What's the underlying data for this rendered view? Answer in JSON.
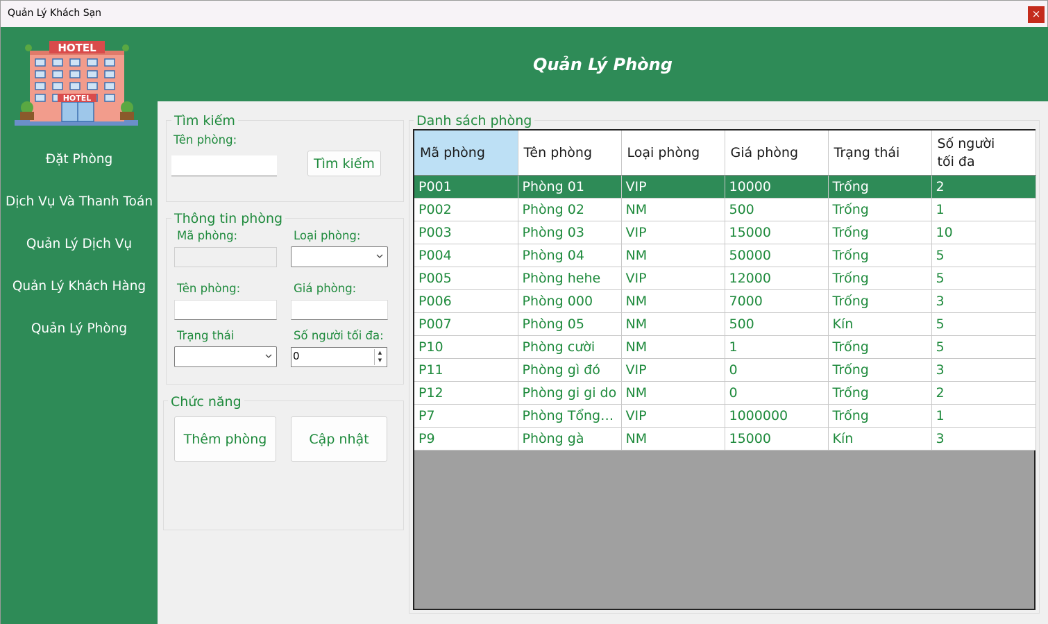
{
  "window": {
    "title": "Quản Lý Khách Sạn",
    "close_label": "×"
  },
  "sidebar": {
    "logo_text_top": "HOTEL",
    "logo_text_door": "HOTEL",
    "items": [
      {
        "label": "Đặt Phòng"
      },
      {
        "label": "Dịch Vụ Và Thanh Toán"
      },
      {
        "label": "Quản Lý Dịch Vụ"
      },
      {
        "label": "Quản Lý Khách Hàng"
      },
      {
        "label": "Quản Lý Phòng"
      }
    ]
  },
  "header": {
    "title": "Quản Lý Phòng"
  },
  "search": {
    "legend": "Tìm kiếm",
    "name_label": "Tên phòng:",
    "name_value": "",
    "button_label": "Tìm kiếm"
  },
  "room_info": {
    "legend": "Thông tin phòng",
    "code_label": "Mã phòng:",
    "code_value": "",
    "type_label": "Loại phòng:",
    "type_value": "",
    "name_label": "Tên phòng:",
    "name_value": "",
    "price_label": "Giá phòng:",
    "price_value": "",
    "status_label": "Trạng thái",
    "status_value": "",
    "max_people_label": "Số người tối đa:",
    "max_people_value": "0"
  },
  "functions": {
    "legend": "Chức năng",
    "add_label": "Thêm phòng",
    "update_label": "Cập nhật"
  },
  "room_list": {
    "legend": "Danh sách phòng",
    "columns": [
      "Mã phòng",
      "Tên phòng",
      "Loại phòng",
      "Giá phòng",
      "Trạng thái",
      "Số người\ntối đa"
    ],
    "rows": [
      [
        "P001",
        "Phòng 01",
        "VIP",
        "10000",
        "Trống",
        "2"
      ],
      [
        "P002",
        "Phòng 02",
        "NM",
        "500",
        "Trống",
        "1"
      ],
      [
        "P003",
        "Phòng 03",
        "VIP",
        "15000",
        "Trống",
        "10"
      ],
      [
        "P004",
        "Phòng 04",
        "NM",
        "50000",
        "Trống",
        "5"
      ],
      [
        "P005",
        "Phòng hehe",
        "VIP",
        "12000",
        "Trống",
        "5"
      ],
      [
        "P006",
        "Phòng 000",
        "NM",
        "7000",
        "Trống",
        "3"
      ],
      [
        "P007",
        "Phòng 05",
        "NM",
        "500",
        "Kín",
        "5"
      ],
      [
        "P10",
        "Phòng cười",
        "NM",
        "1",
        "Trống",
        "5"
      ],
      [
        "P11",
        "Phòng gì đó",
        "VIP",
        "0",
        "Trống",
        "3"
      ],
      [
        "P12",
        "Phòng gi gi do",
        "NM",
        "0",
        "Trống",
        "2"
      ],
      [
        "P7",
        "Phòng Tổng t...",
        "VIP",
        "1000000",
        "Trống",
        "1"
      ],
      [
        "P9",
        "Phòng gà",
        "NM",
        "15000",
        "Kín",
        "3"
      ]
    ],
    "selected_row": 0
  },
  "colors": {
    "accent": "#2e8b57",
    "text_green": "#1e8a3c",
    "header_selected": "#bde0f5",
    "grid_empty": "#a0a0a0"
  }
}
